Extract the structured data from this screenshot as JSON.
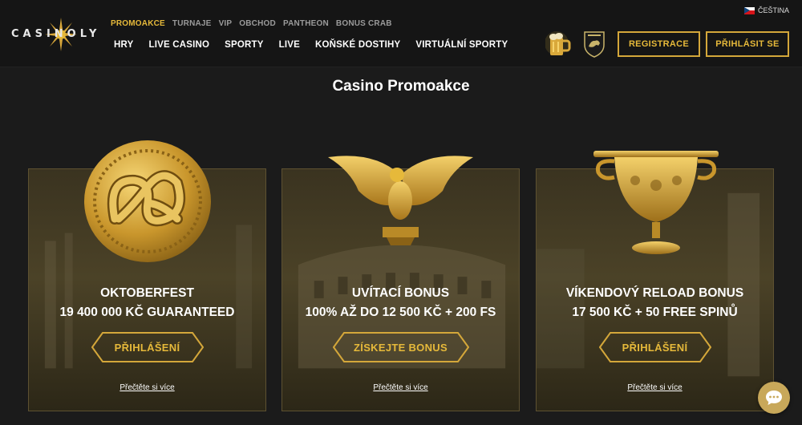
{
  "brand": {
    "logo_text": "CASINOLY"
  },
  "header": {
    "top_nav": [
      "PROMOAKCE",
      "TURNAJE",
      "VIP",
      "OBCHOD",
      "PANTHEON",
      "BONUS CRAB"
    ],
    "main_nav": [
      "HRY",
      "LIVE CASINO",
      "SPORTY",
      "LIVE",
      "KOŇSKÉ DOSTIHY",
      "VIRTUÁLNÍ SPORTY"
    ],
    "language": "ČEŠTINA",
    "register_label": "REGISTRACE",
    "login_label": "PŘIHLÁSIT SE"
  },
  "page": {
    "title": "Casino Promoakce"
  },
  "cards": [
    {
      "title_line1": "OKTOBERFEST",
      "title_line2": "19 400 000 KČ GUARANTEED",
      "button": "PŘIHLÁŠENÍ",
      "link": "Přečtěte si více"
    },
    {
      "title_line1": "UVÍTACÍ BONUS",
      "title_line2": "100% AŽ DO 12 500 KČ + 200 FS",
      "button": "ZÍSKEJTE BONUS",
      "link": "Přečtěte si více"
    },
    {
      "title_line1": "VÍKENDOVÝ RELOAD BONUS",
      "title_line2": "17 500 KČ + 50 FREE SPINŮ",
      "button": "PŘIHLÁŠENÍ",
      "link": "Přečtěte si více"
    }
  ],
  "colors": {
    "accent": "#e6b93a",
    "background": "#1b1b1b",
    "header": "#151515"
  },
  "icons": [
    "sun-logo-icon",
    "beer-mug-icon",
    "lamborghini-shield-icon",
    "chat-icon"
  ]
}
